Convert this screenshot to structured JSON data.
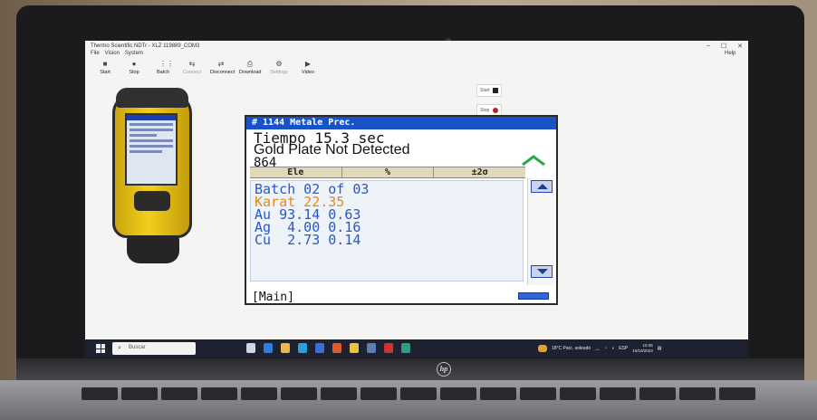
{
  "window": {
    "title": "Thermo Scientific NDTr - XLZ 119889_COM3",
    "controls": [
      "–",
      "☐",
      "✕"
    ]
  },
  "menu": {
    "items": [
      "File",
      "Vision",
      "System"
    ],
    "help": "Help"
  },
  "toolbar": {
    "items": [
      {
        "label": "Start",
        "icon": "start-icon"
      },
      {
        "label": "Stop",
        "icon": "stop-icon"
      },
      {
        "label": "Batch",
        "icon": "batch-icon"
      },
      {
        "label": "Connect",
        "icon": "connect-icon",
        "disabled": true
      },
      {
        "label": "Disconnect",
        "icon": "disconnect-icon"
      },
      {
        "label": "Download",
        "icon": "download-icon"
      },
      {
        "label": "Settings",
        "icon": "settings-icon",
        "disabled": true
      },
      {
        "label": "Video",
        "icon": "video-icon"
      }
    ]
  },
  "side_buttons": {
    "start": "Start",
    "stop": "Stop"
  },
  "analyzer": {
    "title": "# 1144 Metale Prec.",
    "time_line": "Tiempo 15.3 sec",
    "status_line": "Gold Plate Not Detected",
    "reading_id": "864",
    "columns": [
      "Ele",
      "%",
      "±2σ"
    ],
    "rows": [
      {
        "text": "Batch 02 of 03",
        "kind": "batch"
      },
      {
        "text": "Karat 22.35",
        "kind": "karat"
      },
      {
        "text": "Au 93.14 0.63",
        "kind": "element"
      },
      {
        "text": "Ag  4.00 0.16",
        "kind": "element"
      },
      {
        "text": "Cu  2.73 0.14",
        "kind": "element"
      }
    ],
    "footer": "[Main]"
  },
  "taskbar": {
    "search_placeholder": "Buscar",
    "weather": "18°C Parc. soleado",
    "language": "ESP",
    "time": "10:35",
    "date": "10/10/2023"
  },
  "colors": {
    "title_bar": "#1852c6",
    "row_text": "#2a56c8",
    "karat_text": "#e08a1a",
    "header_bg": "#e2d7b6",
    "taskbar": "#1e2230"
  }
}
